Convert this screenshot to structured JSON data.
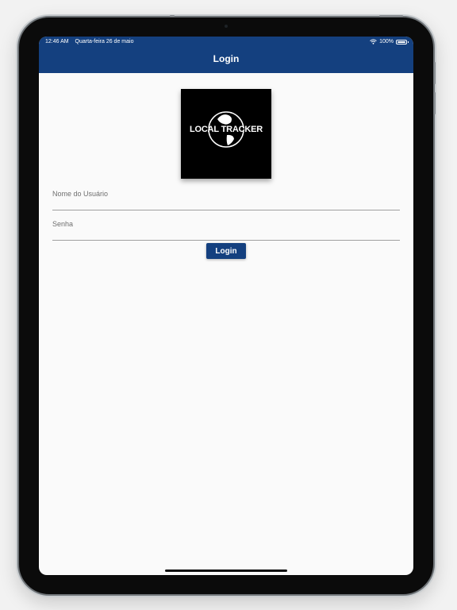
{
  "status_bar": {
    "time": "12:46 AM",
    "date": "Quarta-feira 26 de maio",
    "battery": "100%"
  },
  "header": {
    "title": "Login"
  },
  "logo": {
    "text": "LOCAL TRACKER",
    "icon": "globe-icon"
  },
  "form": {
    "username_placeholder": "Nome do Usuário",
    "password_placeholder": "Senha",
    "login_label": "Login"
  },
  "colors": {
    "primary": "#14407f",
    "background": "#fafafa",
    "logo_bg": "#000000"
  }
}
